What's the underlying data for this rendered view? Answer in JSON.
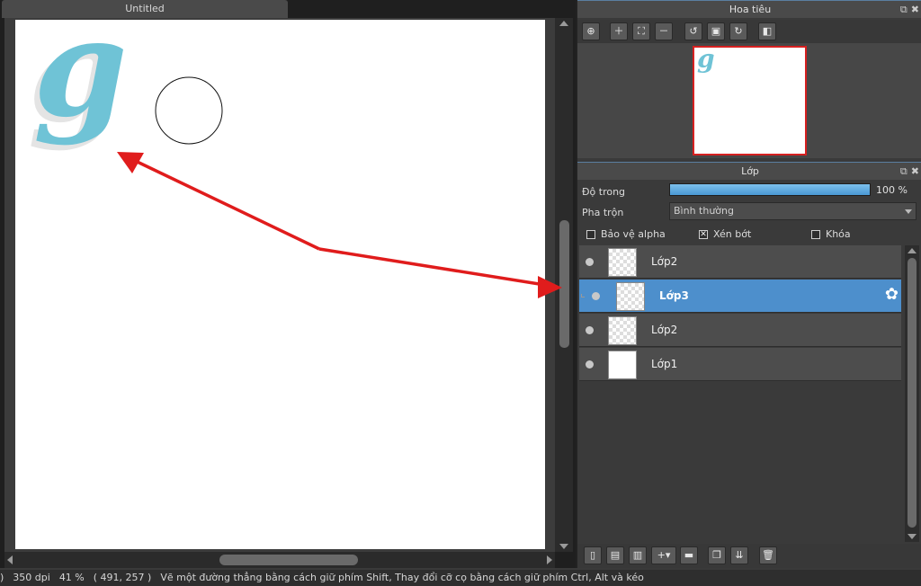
{
  "document": {
    "tab_title": "Untitled"
  },
  "canvas": {
    "glyph": "g",
    "glyph_color": "#6fc3d6",
    "arrow_color": "#e01c1c"
  },
  "navigator": {
    "title": "Hoa tiêu",
    "toolbar_icons": [
      "zoom-actual-icon",
      "zoom-in-icon",
      "fit-window-icon",
      "zoom-out-icon",
      "rotate-left-icon",
      "fit-selection-icon",
      "rotate-right-icon",
      "flip-horizontal-icon"
    ]
  },
  "layers_panel": {
    "title": "Lớp",
    "opacity_label": "Độ trong",
    "opacity_value": "100 %",
    "opacity_percent": 100,
    "blend_label": "Pha trộn",
    "blend_value": "Bình thường",
    "protect_alpha_label": "Bảo vệ alpha",
    "protect_alpha_checked": false,
    "clipping_label": "Xén bớt",
    "clipping_checked": true,
    "lock_label": "Khóa",
    "lock_checked": false,
    "accent_color": "#4d8fcc",
    "layers": [
      {
        "name": "Lớp2",
        "selected": false,
        "clipped": false
      },
      {
        "name": "Lớp3",
        "selected": true,
        "clipped": true
      },
      {
        "name": "Lớp2",
        "selected": false,
        "clipped": false
      },
      {
        "name": "Lớp1",
        "selected": false,
        "clipped": false
      }
    ],
    "toolbar_icons": [
      "new-layer-icon",
      "new-halftone-layer-icon",
      "new-8bit-layer-icon",
      "add-layer-menu-icon",
      "new-folder-icon",
      "duplicate-layer-icon",
      "merge-down-icon",
      "delete-layer-icon"
    ]
  },
  "status": {
    "prefix": ")",
    "dpi": "350 dpi",
    "zoom": "41 %",
    "coords": "( 491, 257 )",
    "hint": "Vẽ một đường thẳng bằng cách giữ phím Shift, Thay đổi cỡ cọ bằng cách giữ phím Ctrl, Alt và kéo"
  }
}
